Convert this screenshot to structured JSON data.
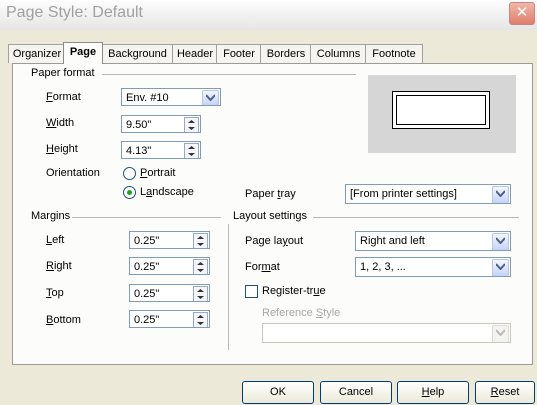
{
  "window": {
    "title": "Page Style: Default",
    "close_glyph": "✕"
  },
  "tabs": [
    {
      "label": "Organizer"
    },
    {
      "label": "Page"
    },
    {
      "label": "Background"
    },
    {
      "label": "Header"
    },
    {
      "label": "Footer"
    },
    {
      "label": "Borders"
    },
    {
      "label": "Columns"
    },
    {
      "label": "Footnote"
    }
  ],
  "paper_format": {
    "heading": "Paper format",
    "format_label_pre": "",
    "format_label_ul": "F",
    "format_label_post": "ormat",
    "format_value": "Env. #10",
    "width_label_pre": "",
    "width_label_ul": "W",
    "width_label_post": "idth",
    "width_value": "9.50\"",
    "height_label_pre": "",
    "height_label_ul": "H",
    "height_label_post": "eight",
    "height_value": "4.13\"",
    "orientation_label": "Orientation",
    "portrait_pre": "",
    "portrait_ul": "P",
    "portrait_post": "ortrait",
    "landscape_pre": "L",
    "landscape_ul": "a",
    "landscape_post": "ndscape",
    "orientation_selected": "landscape",
    "paper_tray_pre": "Paper ",
    "paper_tray_ul": "t",
    "paper_tray_post": "ray",
    "paper_tray_value": "[From printer settings]"
  },
  "margins": {
    "heading": "Margins",
    "left_pre": "",
    "left_ul": "L",
    "left_post": "eft",
    "left_value": "0.25\"",
    "right_pre": "",
    "right_ul": "R",
    "right_post": "ight",
    "right_value": "0.25\"",
    "top_pre": "",
    "top_ul": "T",
    "top_post": "op",
    "top_value": "0.25\"",
    "bottom_pre": "",
    "bottom_ul": "B",
    "bottom_post": "ottom",
    "bottom_value": "0.25\""
  },
  "layout": {
    "heading": "Layout settings",
    "page_layout_pre": "Page la",
    "page_layout_ul": "y",
    "page_layout_post": "out",
    "page_layout_value": "Right and left",
    "format_pre": "For",
    "format_ul": "m",
    "format_post": "at",
    "format_value": "1, 2, 3, ...",
    "register_true_pre": "Register-tr",
    "register_true_ul": "u",
    "register_true_post": "e",
    "register_true_checked": false,
    "reference_style_pre": "Reference ",
    "reference_style_ul": "S",
    "reference_style_post": "tyle",
    "reference_style_value": ""
  },
  "buttons": {
    "ok": "OK",
    "cancel": "Cancel",
    "help_pre": "",
    "help_ul": "H",
    "help_post": "elp",
    "reset_pre": "",
    "reset_ul": "R",
    "reset_post": "eset"
  },
  "colors": {
    "dialog_bg": "#ece9d8",
    "panel_bg": "#fcfcfb",
    "radio_dot": "#21a121"
  }
}
